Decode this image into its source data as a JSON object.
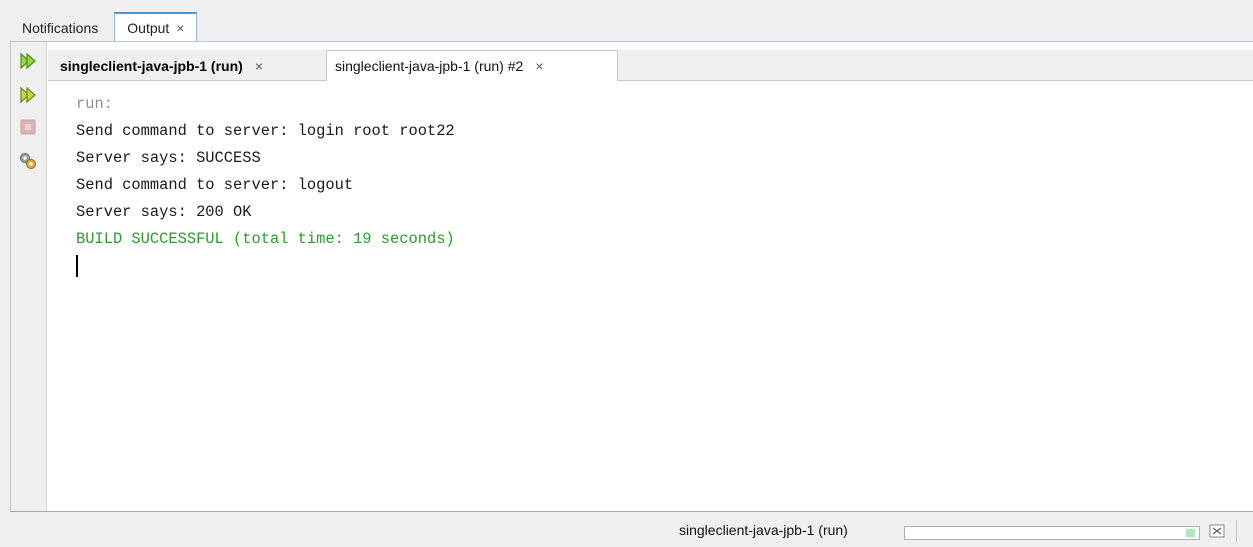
{
  "window_tabs": [
    {
      "label": "Notifications"
    },
    {
      "label": "Output",
      "close": "×"
    }
  ],
  "run_tabs": [
    {
      "label": "singleclient-java-jpb-1 (run)",
      "close": "×"
    },
    {
      "label": "singleclient-java-jpb-1 (run) #2",
      "close": "×"
    }
  ],
  "toolbar": {
    "icons": [
      "rerun-icon",
      "rerun-with-params-icon",
      "stop-icon",
      "settings-icon"
    ]
  },
  "console": {
    "lines": [
      "run:",
      "Send command to server: login root root22",
      "Server says: SUCCESS",
      "Send command to server: logout",
      "Server says: 200 OK",
      "BUILD SUCCESSFUL (total time: 19 seconds)"
    ]
  },
  "status": {
    "task": "singleclient-java-jpb-1 (run)",
    "progress": 0.03,
    "progress_color": "#b0e6c2"
  },
  "colors": {
    "success": "#2c9a2c",
    "dim": "#909090",
    "accent": "#4f93d6"
  }
}
